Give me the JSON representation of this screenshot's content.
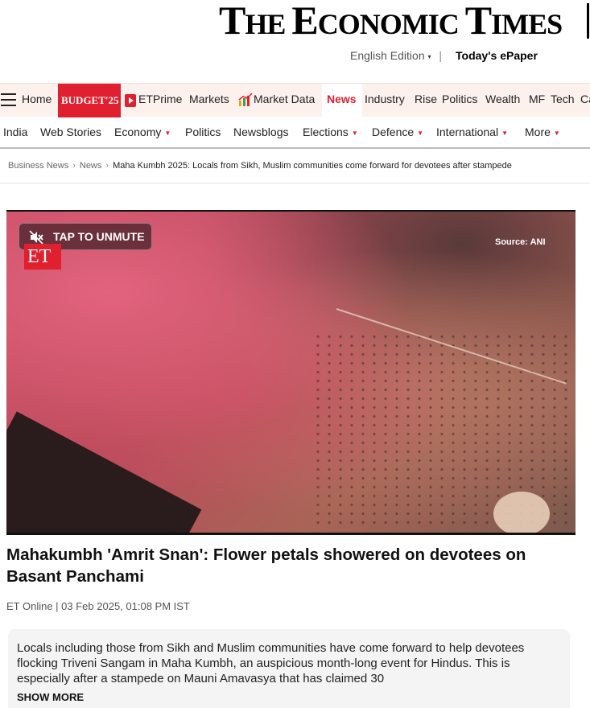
{
  "masthead": {
    "logo_parts": [
      "T",
      "HE ",
      "E",
      "CONOMIC ",
      "T",
      "IMES"
    ],
    "edition_label": "English Edition",
    "edition_caret": "▾",
    "separator": "|",
    "epaper_label": "Today's ePaper"
  },
  "nav": {
    "home": "Home",
    "budget": "BUDGET'25",
    "etprime": "ETPrime",
    "markets": "Markets",
    "market_data": "Market Data",
    "news": "News",
    "industry": "Industry",
    "rise": "Rise",
    "politics": "Politics",
    "wealth": "Wealth",
    "mf": "MF",
    "tech": "Tech",
    "cut": "Ca"
  },
  "subnav": {
    "india": "India",
    "web_stories": "Web Stories",
    "economy": "Economy",
    "politics": "Politics",
    "newsblogs": "Newsblogs",
    "elections": "Elections",
    "defence": "Defence",
    "international": "International",
    "more": "More",
    "dropdown_glyph": "▼"
  },
  "breadcrumb": {
    "items": [
      "Business News",
      "News"
    ],
    "current": "Maha Kumbh 2025: Locals from Sikh, Muslim communities come forward for devotees after stampede",
    "sep": "›"
  },
  "video": {
    "unmute_label": "TAP TO UNMUTE",
    "logo_text": "ET",
    "source_label": "Source: ANI"
  },
  "article": {
    "headline": "Mahakumbh 'Amrit Snan': Flower petals showered on devotees on Basant Panchami",
    "byline": "ET Online | 03 Feb 2025, 01:08 PM IST",
    "summary": "Locals including those from Sikh and Muslim communities have come forward to help devotees flocking Triveni Sangam in Maha Kumbh, an auspicious month-long event for Hindus. This is especially after a stampede on Mauni Amavasya that has claimed 30",
    "show_more": "SHOW MORE"
  },
  "colors": {
    "brand_red": "#e01f2f",
    "nav_bg": "#fdf1ee"
  }
}
